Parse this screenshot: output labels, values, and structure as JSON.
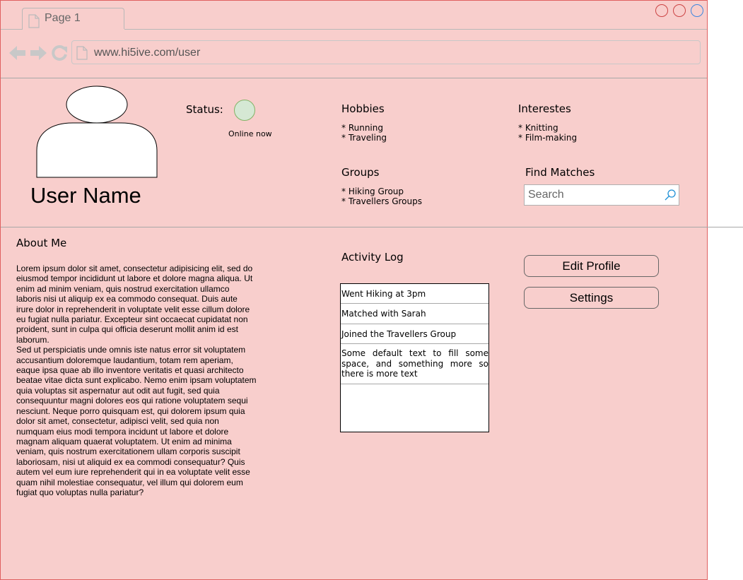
{
  "browser": {
    "tab_title": "Page 1",
    "url": "www.hi5ive.com/user",
    "icons": [
      "back-icon",
      "forward-icon",
      "reload-icon",
      "page-icon"
    ]
  },
  "profile": {
    "user_name": "User Name",
    "status_label": "Status:",
    "status_text": "Online now",
    "status_color": "#d5e8d4"
  },
  "hobbies": {
    "title": "Hobbies",
    "items": [
      "* Running",
      "* Traveling"
    ]
  },
  "interests": {
    "title": "Interestes",
    "items": [
      "* Knitting",
      "* Film-making"
    ]
  },
  "groups": {
    "title": "Groups",
    "items": [
      "* Hiking Group",
      "* Travellers Groups"
    ]
  },
  "find_matches": {
    "title": "Find Matches",
    "search_placeholder": "Search"
  },
  "about": {
    "title": "About Me",
    "paragraphs": [
      "Lorem ipsum dolor sit amet, consectetur adipisicing elit, sed do eiusmod tempor incididunt ut labore et dolore magna aliqua. Ut enim ad minim veniam, quis nostrud exercitation ullamco laboris nisi ut aliquip ex ea commodo consequat. Duis aute irure dolor in reprehenderit in voluptate velit esse cillum dolore eu fugiat nulla pariatur. Excepteur sint occaecat cupidatat non proident, sunt in culpa qui officia deserunt mollit anim id est laborum.",
      "Sed ut perspiciatis unde omnis iste natus error sit voluptatem accusantium doloremque laudantium, totam rem aperiam, eaque ipsa quae ab illo inventore veritatis et quasi architecto beatae vitae dicta sunt explicabo. Nemo enim ipsam voluptatem quia voluptas sit aspernatur aut odit aut fugit, sed quia consequuntur magni dolores eos qui ratione voluptatem sequi nesciunt. Neque porro quisquam est, qui dolorem ipsum quia dolor sit amet, consectetur, adipisci velit, sed quia non numquam eius modi tempora incidunt ut labore et dolore magnam aliquam quaerat voluptatem. Ut enim ad minima veniam, quis nostrum exercitationem ullam corporis suscipit laboriosam, nisi ut aliquid ex ea commodi consequatur? Quis autem vel eum iure reprehenderit qui in ea voluptate velit esse quam nihil molestiae consequatur, vel illum qui dolorem eum fugiat quo voluptas nulla pariatur?"
    ]
  },
  "activity": {
    "title": "Activity Log",
    "items": [
      "Went Hiking at 3pm",
      "Matched with Sarah",
      "Joined the Travellers Group",
      "Some default text to fill some space, and something more so there is more text"
    ]
  },
  "actions": {
    "edit_profile": "Edit Profile",
    "settings": "Settings"
  },
  "colors": {
    "background": "#f8cecc",
    "status_dot": "#d5e8d4",
    "maximize_button": "#3d87e0",
    "close_buttons": "#cc4444"
  }
}
